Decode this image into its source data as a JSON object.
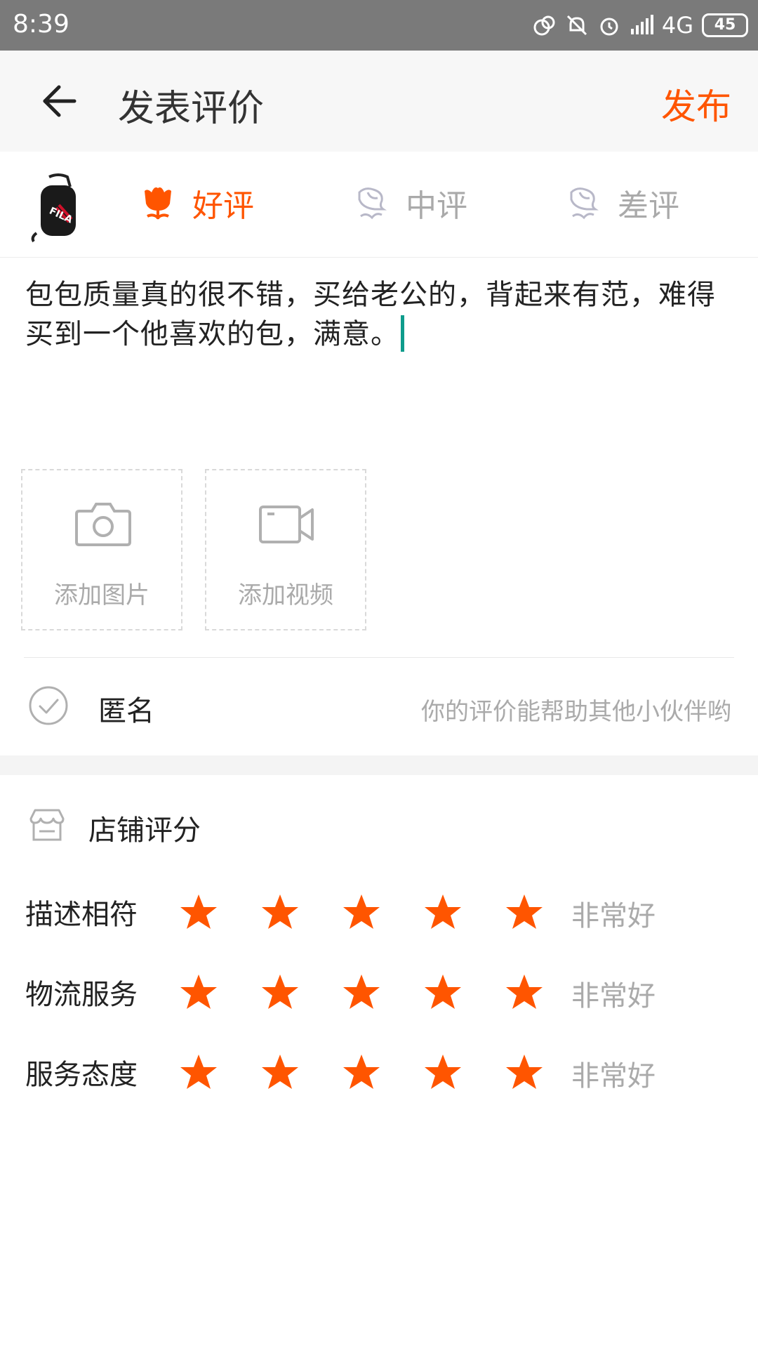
{
  "status_bar": {
    "time": "8:39",
    "network": "4G",
    "battery": "45"
  },
  "header": {
    "title": "发表评价",
    "publish_label": "发布"
  },
  "rating_tabs": [
    {
      "label": "好评",
      "selected": true
    },
    {
      "label": "中评",
      "selected": false
    },
    {
      "label": "差评",
      "selected": false
    }
  ],
  "review": {
    "text": "包包质量真的很不错，买给老公的，背起来有范，难得买到一个他喜欢的包，满意。"
  },
  "media": {
    "add_photo_label": "添加图片",
    "add_video_label": "添加视频"
  },
  "anonymous": {
    "label": "匿名",
    "hint": "你的评价能帮助其他小伙伴哟"
  },
  "store_rating": {
    "title": "店铺评分",
    "rows": [
      {
        "label": "描述相符",
        "stars": 5,
        "value": "非常好"
      },
      {
        "label": "物流服务",
        "stars": 5,
        "value": "非常好"
      },
      {
        "label": "服务态度",
        "stars": 5,
        "value": "非常好"
      }
    ]
  },
  "colors": {
    "accent": "#ff5500",
    "muted": "#aaaaaa",
    "caret": "#0e9c8c"
  }
}
